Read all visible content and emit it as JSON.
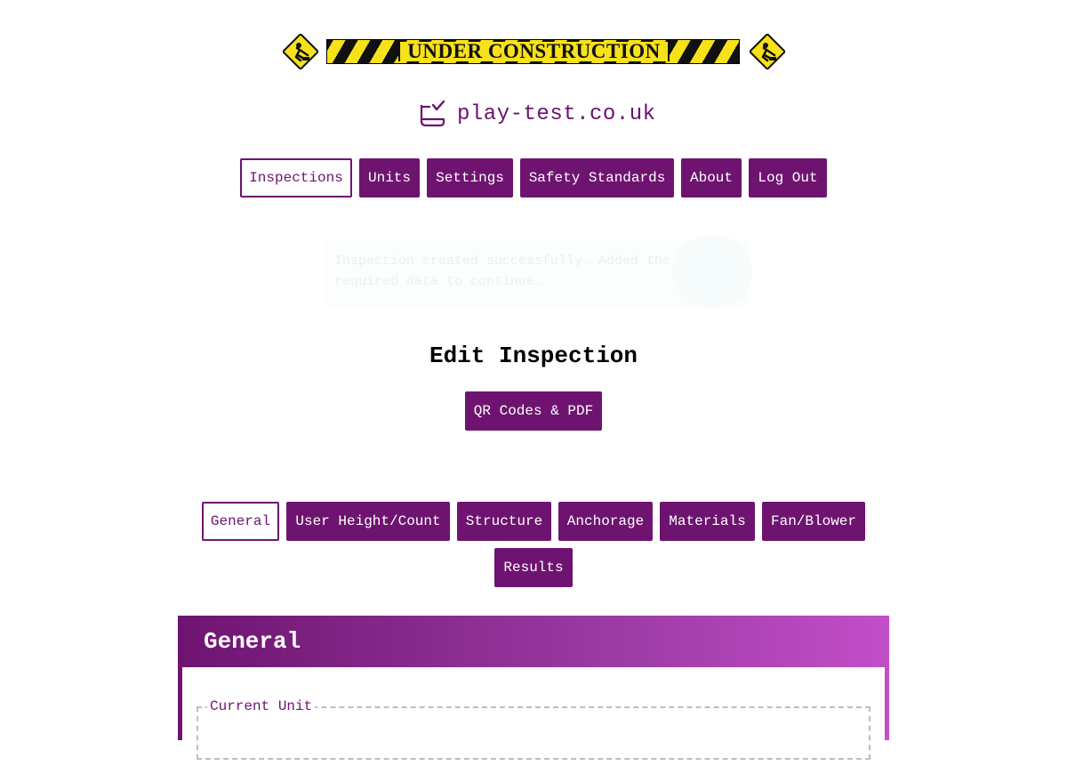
{
  "banner": {
    "text": "UNDER CONSTRUCTION",
    "warning_icon": "construction-worker-icon"
  },
  "brand": {
    "icon": "checklist-icon",
    "name": "play-test.co.uk"
  },
  "nav": {
    "items": [
      {
        "label": "Inspections",
        "active": true
      },
      {
        "label": "Units"
      },
      {
        "label": "Settings"
      },
      {
        "label": "Safety Standards"
      },
      {
        "label": "About"
      },
      {
        "label": "Log Out"
      }
    ]
  },
  "flash": {
    "message": "Inspection created successfully. Added the required data to continue."
  },
  "page": {
    "title": "Edit Inspection",
    "qr_button": "QR Codes & PDF"
  },
  "tabs": {
    "items": [
      {
        "label": "General",
        "active": true
      },
      {
        "label": "User Height/Count"
      },
      {
        "label": "Structure"
      },
      {
        "label": "Anchorage"
      },
      {
        "label": "Materials"
      },
      {
        "label": "Fan/Blower"
      },
      {
        "label": "Results"
      }
    ]
  },
  "section": {
    "title": "General",
    "legend": "Current Unit"
  },
  "colors": {
    "brand_purple": "#6e1470",
    "gradient_end": "#c34ec9",
    "banner_yellow": "#f7e11b"
  }
}
